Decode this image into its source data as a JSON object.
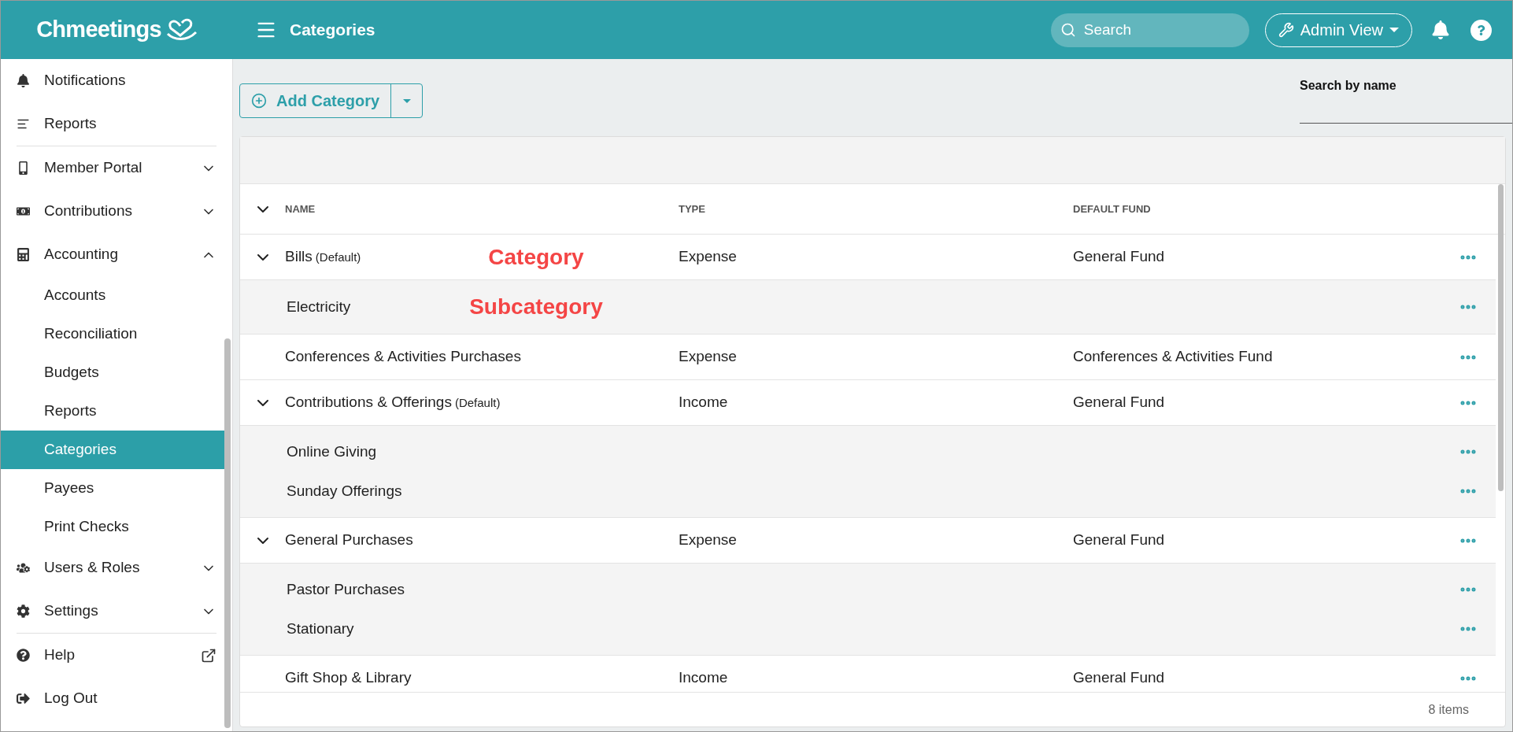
{
  "header": {
    "logo": "Chmeetings",
    "title": "Categories",
    "search": {
      "placeholder": "Search"
    },
    "view_button": "Admin View"
  },
  "sidebar": {
    "sections": [
      [
        {
          "label": "Notifications"
        },
        {
          "label": "Reports"
        }
      ],
      [
        {
          "label": "Member Portal",
          "expanded": false
        },
        {
          "label": "Contributions",
          "expanded": false
        },
        {
          "label": "Accounting",
          "expanded": true,
          "children": [
            {
              "label": "Accounts",
              "selected": false
            },
            {
              "label": "Reconciliation",
              "selected": false
            },
            {
              "label": "Budgets",
              "selected": false
            },
            {
              "label": "Reports",
              "selected": false
            },
            {
              "label": "Categories",
              "selected": true
            },
            {
              "label": "Payees",
              "selected": false
            },
            {
              "label": "Print Checks",
              "selected": false
            }
          ]
        },
        {
          "label": "Users & Roles",
          "expanded": false
        },
        {
          "label": "Settings",
          "expanded": false
        }
      ],
      [
        {
          "label": "Help",
          "external": true
        },
        {
          "label": "Log Out"
        }
      ]
    ]
  },
  "toolbar": {
    "add_button": "Add Category",
    "search_label": "Search by name"
  },
  "table": {
    "columns": [
      "NAME",
      "TYPE",
      "DEFAULT FUND"
    ],
    "rows": [
      {
        "name": "Bills",
        "tag": "(Default)",
        "type": "Expense",
        "fund": "General Fund",
        "expanded": true,
        "annotation": "Category",
        "children": [
          {
            "name": "Electricity",
            "annotation": "Subcategory"
          }
        ]
      },
      {
        "name": "Conferences & Activities Purchases",
        "type": "Expense",
        "fund": "Conferences & Activities Fund"
      },
      {
        "name": "Contributions & Offerings",
        "tag": "(Default)",
        "type": "Income",
        "fund": "General Fund",
        "expanded": true,
        "children": [
          {
            "name": "Online Giving"
          },
          {
            "name": "Sunday Offerings"
          }
        ]
      },
      {
        "name": "General Purchases",
        "type": "Expense",
        "fund": "General Fund",
        "expanded": true,
        "children": [
          {
            "name": "Pastor Purchases"
          },
          {
            "name": "Stationary"
          }
        ]
      },
      {
        "name": "Gift Shop & Library",
        "type": "Income",
        "fund": "General Fund"
      }
    ],
    "footer": "8 items"
  }
}
